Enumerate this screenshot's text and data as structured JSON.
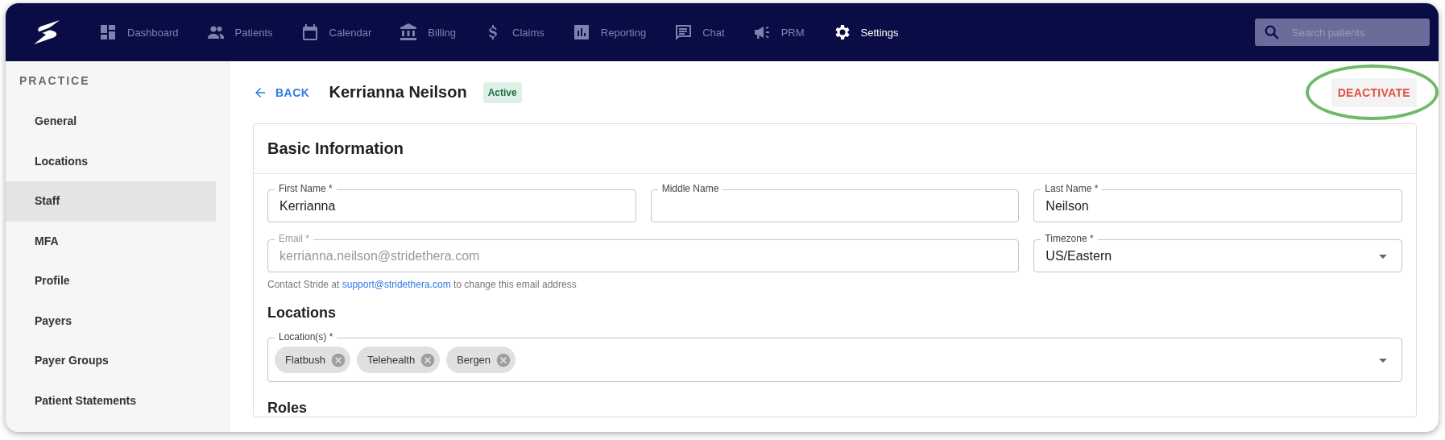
{
  "nav": {
    "items": [
      {
        "label": "Dashboard",
        "selected": false
      },
      {
        "label": "Patients",
        "selected": false
      },
      {
        "label": "Calendar",
        "selected": false
      },
      {
        "label": "Billing",
        "selected": false
      },
      {
        "label": "Claims",
        "selected": false
      },
      {
        "label": "Reporting",
        "selected": false
      },
      {
        "label": "Chat",
        "selected": false
      },
      {
        "label": "PRM",
        "selected": false
      },
      {
        "label": "Settings",
        "selected": true
      }
    ],
    "search": {
      "placeholder": "Search patients"
    }
  },
  "sidebar": {
    "section": "PRACTICE",
    "items": [
      {
        "label": "General",
        "selected": false
      },
      {
        "label": "Locations",
        "selected": false
      },
      {
        "label": "Staff",
        "selected": true
      },
      {
        "label": "MFA",
        "selected": false
      },
      {
        "label": "Profile",
        "selected": false
      },
      {
        "label": "Payers",
        "selected": false
      },
      {
        "label": "Payer Groups",
        "selected": false
      },
      {
        "label": "Patient Statements",
        "selected": false
      }
    ]
  },
  "header": {
    "back": "BACK",
    "title": "Kerrianna Neilson",
    "status": "Active",
    "action": "DEACTIVATE",
    "action_highlighted": true
  },
  "basic_information": {
    "title": "Basic Information",
    "name_fields": [
      {
        "label": "First Name *",
        "value": "Kerrianna",
        "kind": "text",
        "disabled": false
      },
      {
        "label": "Middle Name",
        "kind": "text",
        "disabled": false
      },
      {
        "label": "Last Name *",
        "value": "Neilson",
        "kind": "text",
        "disabled": false
      }
    ],
    "email": {
      "label": "Email *",
      "value": "kerrianna.neilson@stridethera.com",
      "kind": "text",
      "disabled": true
    },
    "timezone": {
      "label": "Timezone *",
      "value": "US/Eastern",
      "kind": "select",
      "disabled": false
    },
    "helper": {
      "before": "Contact Stride at",
      "link": "support@stridethera.com",
      "after": "to change this email address"
    }
  },
  "locations": {
    "title": "Locations",
    "field": {
      "label": "Location(s) *",
      "chips": [
        "Flatbush",
        "Telehealth",
        "Bergen"
      ]
    }
  },
  "roles": {
    "title": "Roles"
  }
}
